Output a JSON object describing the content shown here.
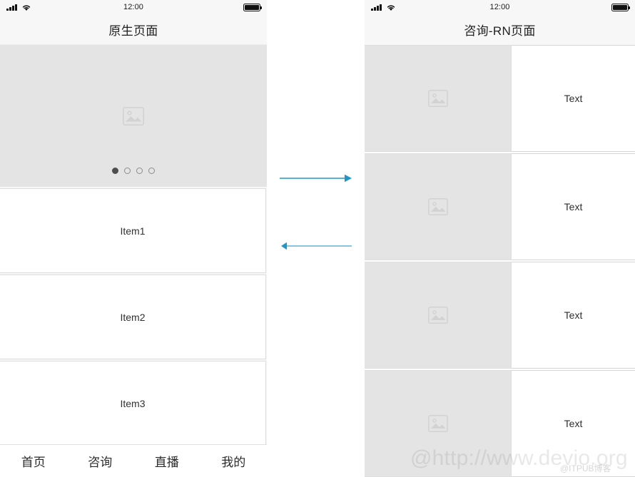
{
  "left_phone": {
    "status_bar": {
      "time": "12:00",
      "signal_icon": "signal-bars-icon",
      "wifi_icon": "wifi-icon",
      "battery_icon": "battery-full-icon"
    },
    "nav_title": "原生页面",
    "carousel": {
      "placeholder_icon": "image-placeholder-icon",
      "dots_total": 4,
      "active_dot_index": 0
    },
    "list_items": [
      {
        "label": "Item1"
      },
      {
        "label": "Item2"
      },
      {
        "label": "Item3"
      }
    ],
    "tab_bar": [
      {
        "label": "首页"
      },
      {
        "label": "咨询"
      },
      {
        "label": "直播"
      },
      {
        "label": "我的"
      }
    ]
  },
  "right_phone": {
    "status_bar": {
      "time": "12:00",
      "signal_icon": "signal-bars-icon",
      "wifi_icon": "wifi-icon",
      "battery_icon": "battery-full-icon"
    },
    "nav_title": "咨询-RN页面",
    "feed_rows": [
      {
        "thumb_icon": "image-placeholder-icon",
        "text": "Text"
      },
      {
        "thumb_icon": "image-placeholder-icon",
        "text": "Text"
      },
      {
        "thumb_icon": "image-placeholder-icon",
        "text": "Text"
      },
      {
        "thumb_icon": "image-placeholder-icon",
        "text": "Text"
      }
    ]
  },
  "connectors": {
    "accent_color": "#2196c4",
    "top_arrow": {
      "direction": "right",
      "name": "arrow-right"
    },
    "bottom_arrow": {
      "direction": "left",
      "name": "arrow-left"
    }
  },
  "watermarks": {
    "primary": "@http://www.devio.org",
    "secondary": "@ITPUB博客"
  }
}
